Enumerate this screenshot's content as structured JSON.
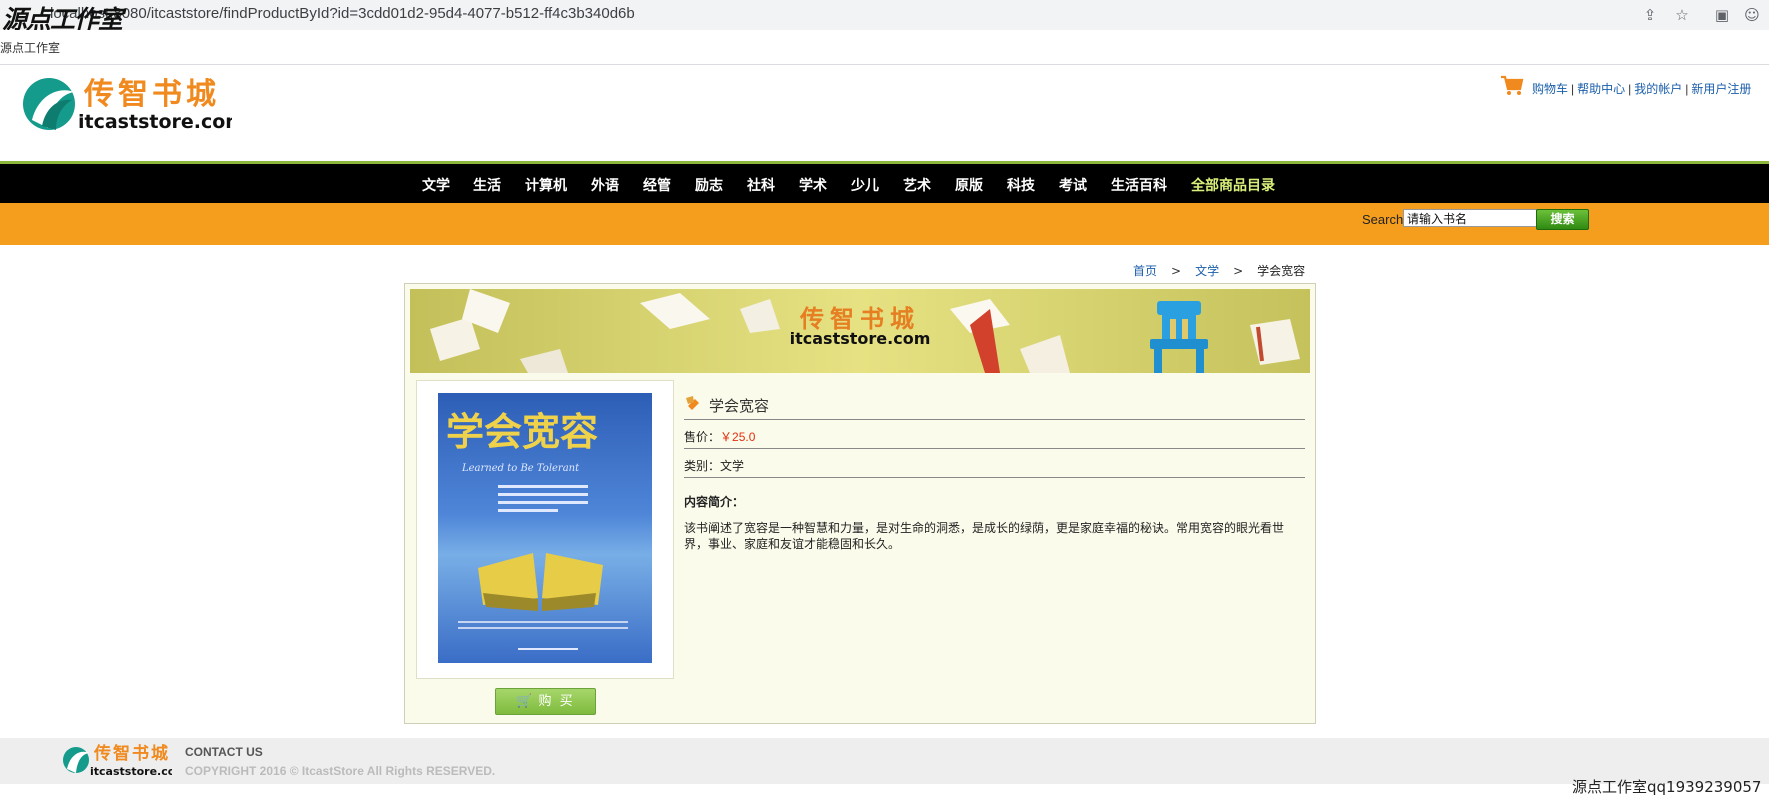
{
  "browser": {
    "url": "localhost:8080/itcaststore/findProductById?id=3cdd01d2-95d4-4077-b512-ff4c3b340d6b",
    "bookmark": "源点工作室"
  },
  "watermark_text": "源点工作室",
  "logo": {
    "cn": "传智书城",
    "en": "itcaststore.com"
  },
  "top_links": [
    "购物车",
    "帮助中心",
    "我的帐户",
    "新用户注册"
  ],
  "nav": [
    "文学",
    "生活",
    "计算机",
    "外语",
    "经管",
    "励志",
    "社科",
    "学术",
    "少儿",
    "艺术",
    "原版",
    "科技",
    "考试",
    "生活百科",
    "全部商品目录"
  ],
  "nav_highlight_color": "#d9f07a",
  "search": {
    "label": "Search",
    "value": "请输入书名",
    "button": "搜索"
  },
  "breadcrumb": {
    "home": "首页",
    "category": "文学",
    "current": "学会宽容"
  },
  "banner": {
    "cn": "传智书城",
    "en": "itcaststore.com"
  },
  "product": {
    "title": "学会宽容",
    "price_label": "售价：",
    "price": "￥25.0",
    "category_label": "类别：",
    "category": "文学",
    "desc_label": "内容简介：",
    "description": "该书阐述了宽容是一种智慧和力量，是对生命的洞悉，是成长的绿荫，更是家庭幸福的秘诀。常用宽容的眼光看世界，事业、家庭和友谊才能稳固和长久。",
    "buy_button": "购 买",
    "cover_title": "学会宽容",
    "cover_subtitle": "Learned to Be Tolerant"
  },
  "footer": {
    "contact": "CONTACT US",
    "copyright": "COPYRIGHT 2016 © ItcastStore All Rights RESERVED."
  },
  "overlay_text": "源点工作室qq1939239057",
  "colors": {
    "orange": "#f59e1d",
    "green_line": "#8db83b",
    "link": "#1a5eab",
    "price": "#e03010"
  }
}
